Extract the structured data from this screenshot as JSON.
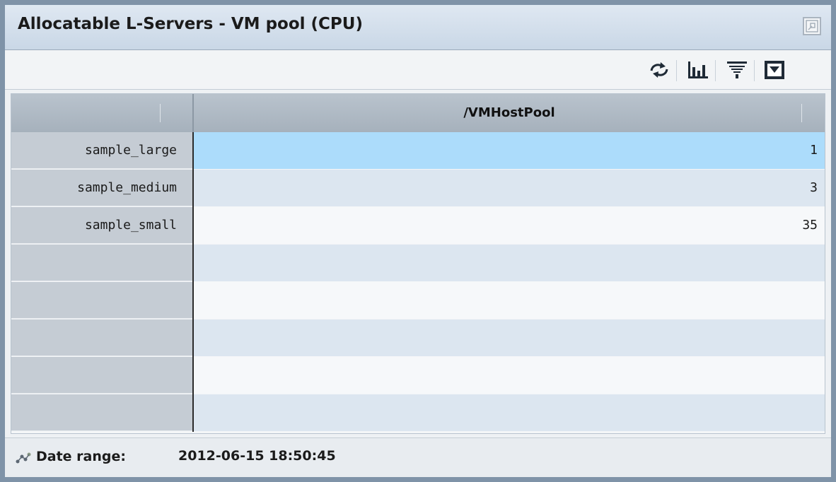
{
  "window": {
    "title": "Allocatable L-Servers - VM pool (CPU)",
    "maximize_icon": "restore-window-icon"
  },
  "toolbar": {
    "buttons": [
      {
        "icon": "refresh-icon"
      },
      {
        "icon": "bar-chart-icon"
      },
      {
        "icon": "filter-icon"
      },
      {
        "icon": "save-icon"
      }
    ]
  },
  "table": {
    "corner_header": "",
    "column_header": "/VMHostPool",
    "rows": [
      {
        "label": "sample_large",
        "value": "1"
      },
      {
        "label": "sample_medium",
        "value": "3"
      },
      {
        "label": "sample_small",
        "value": "35"
      },
      {
        "label": "",
        "value": ""
      },
      {
        "label": "",
        "value": ""
      },
      {
        "label": "",
        "value": ""
      },
      {
        "label": "",
        "value": ""
      },
      {
        "label": "",
        "value": ""
      }
    ],
    "selected_row": 0
  },
  "status": {
    "icon": "range-chart-icon",
    "date_range_label": "Date range:",
    "date_range_value": "2012-06-15 18:50:45"
  },
  "colors": {
    "frame": "#7f93a8",
    "selected_row": "#acdcfb",
    "alt_row": "#dce6f0",
    "header": "#b0bac5"
  }
}
